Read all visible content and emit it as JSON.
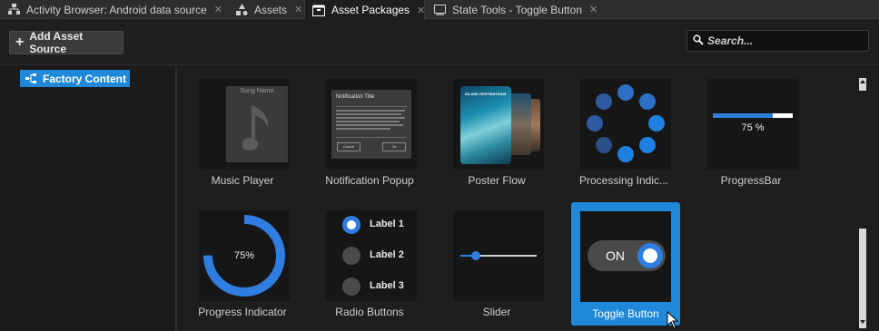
{
  "tabs": [
    {
      "label": "Activity Browser: Android data source",
      "icon": "hierarchy-icon",
      "active": false
    },
    {
      "label": "Assets",
      "icon": "shapes-icon",
      "active": false
    },
    {
      "label": "Asset Packages",
      "icon": "package-icon",
      "active": true
    },
    {
      "label": "State Tools - Toggle Button",
      "icon": "window-icon",
      "active": false
    }
  ],
  "toolbar": {
    "add_label": "Add Asset Source",
    "search_placeholder": "Search..."
  },
  "tree": {
    "item_label": "Factory Content"
  },
  "assets": [
    {
      "label": "Music Player",
      "thumb_text": "Song Name"
    },
    {
      "label": "Notification Popup",
      "thumb_text": "Notification Title",
      "button_cancel": "Cancel",
      "button_ok": "Ok"
    },
    {
      "label": "Poster Flow",
      "thumb_text": "ISLAND DESTINATIONS"
    },
    {
      "label": "Processing Indic...",
      "thumb_text": ""
    },
    {
      "label": "ProgressBar",
      "thumb_text": "75 %",
      "progress": 0.75
    },
    {
      "label": "Progress Indicator",
      "thumb_text": "75%",
      "progress": 0.75
    },
    {
      "label": "Radio Buttons",
      "options": [
        "Label 1",
        "Label 2",
        "Label 3"
      ],
      "selected_index": 0
    },
    {
      "label": "Slider",
      "thumb_text": "",
      "value": 0.2
    },
    {
      "label": "Toggle Button",
      "thumb_text": "ON",
      "selected": true
    }
  ],
  "colors": {
    "accent": "#1f88d8",
    "blue_fill": "#2f7de0",
    "dark_bg": "#1e1e1e"
  }
}
